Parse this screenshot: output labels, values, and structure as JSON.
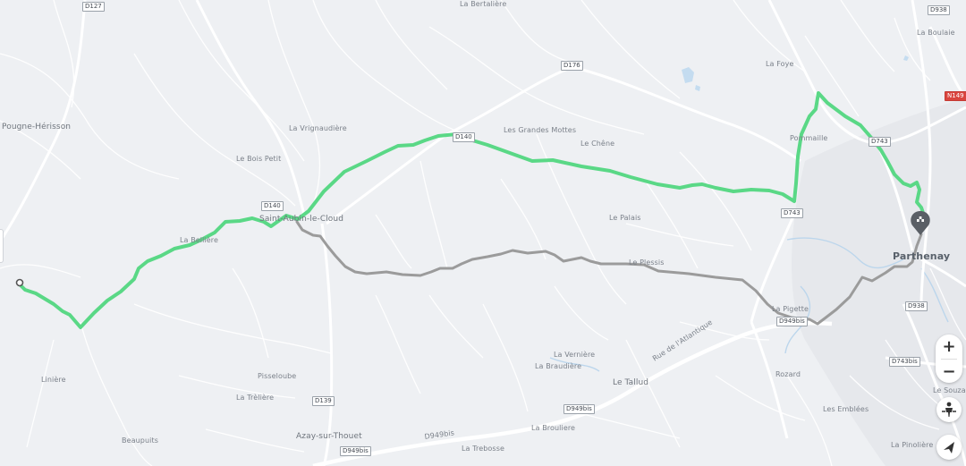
{
  "route": {
    "selected_color": "#5ad886",
    "alternative_color": "#9b9b9b"
  },
  "places": {
    "la_bertaliere": "La Bertalière",
    "la_boulaie": "La Boulaie",
    "la_foye": "La Foye",
    "pougne_herisson": "Pougne-Hérisson",
    "la_vrignaudiere": "La Vrignaudière",
    "les_grandes_mottes": "Les Grandes Mottes",
    "le_chene": "Le Chêne",
    "pommaille": "Pommaille",
    "le_bois_petit": "Le Bois Petit",
    "saint_aubin": "Saint-Aubin-le-Cloud",
    "la_belliere": "La Bellière",
    "le_palais": "Le Palais",
    "parthenay": "Parthenay",
    "le_plessis": "Le Plessis",
    "la_pigette": "La Pigette",
    "la_verniere": "La Vernière",
    "la_braudiere": "La Braudière",
    "le_tallud": "Le Tallud",
    "liniere": "Linière",
    "pisseloube": "Pisseloube",
    "la_treliere": "La Trèlière",
    "rozard": "Rozard",
    "le_souzay": "Le Souzay",
    "les_emblees": "Les Emblées",
    "azay_sur_thouet": "Azay-sur-Thouet",
    "beaupuits": "Beaupuits",
    "la_brouliere": "La Brouliere",
    "la_trebosse": "La Trebosse",
    "la_pinoliere": "La Pinolière",
    "rue_atlantique": "Rue de l'Atlantique"
  },
  "roads": {
    "d127": "D127",
    "d938_top": "D938",
    "d176": "D176",
    "n149": "N149",
    "d140_top": "D140",
    "d743_top": "D743",
    "d140_left": "D140",
    "d743_mid": "D743",
    "d938_mid": "D938",
    "d949bis_right": "D949bis",
    "d743bis": "D743bis",
    "d949bis_mid": "D949bis",
    "d139": "D139",
    "d949bis_bottom": "D949bis",
    "d949bis_road": "D949bis"
  },
  "controls": {
    "zoom_in": "+",
    "zoom_out": "−"
  }
}
